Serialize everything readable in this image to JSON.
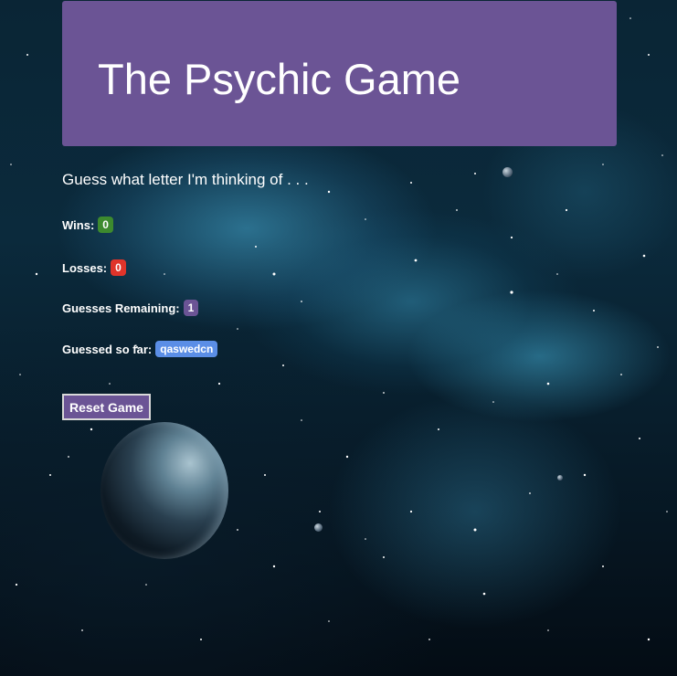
{
  "header": {
    "title": "The Psychic Game",
    "bg_color": "#6b5495"
  },
  "prompt": "Guess what letter I'm thinking of . . .",
  "stats": {
    "wins": {
      "label": "Wins:",
      "value": "0",
      "color": "#3d8a2e"
    },
    "losses": {
      "label": "Losses:",
      "value": "0",
      "color": "#e0342a"
    },
    "guesses_remaining": {
      "label": "Guesses Remaining:",
      "value": "1",
      "color": "#6b5495"
    },
    "guessed_so_far": {
      "label": "Guessed so far:",
      "value": "qaswedcn",
      "color": "#5b8ee6"
    }
  },
  "reset_button": {
    "label": "Reset Game"
  }
}
